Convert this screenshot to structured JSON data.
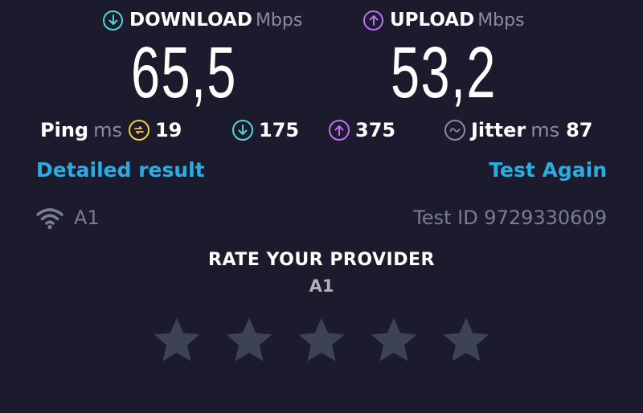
{
  "download": {
    "label": "DOWNLOAD",
    "unit": "Mbps",
    "value": "65,5",
    "icon": "arrow-down-circle-icon",
    "color": "#4fd6d2"
  },
  "upload": {
    "label": "UPLOAD",
    "unit": "Mbps",
    "value": "53,2",
    "icon": "arrow-up-circle-icon",
    "color": "#c06ff0"
  },
  "ping": {
    "label": "Ping",
    "unit": "ms",
    "value": "19",
    "icon": "ping-circle-icon",
    "color": "#f2cf3a"
  },
  "latency_download": {
    "value": "175",
    "icon": "arrow-down-circle-icon",
    "color": "#4fd6d2"
  },
  "latency_upload": {
    "value": "375",
    "icon": "arrow-up-circle-icon",
    "color": "#c06ff0"
  },
  "jitter": {
    "label": "Jitter",
    "unit": "ms",
    "value": "87",
    "icon": "jitter-circle-icon",
    "color": "#8a8c9c"
  },
  "links": {
    "detailed": "Detailed result",
    "test_again": "Test Again"
  },
  "provider": {
    "name": "A1",
    "icon": "wifi-icon"
  },
  "test_id": "Test ID 9729330609",
  "rating": {
    "title": "RATE YOUR PROVIDER",
    "provider": "A1",
    "stars": 5,
    "selected": 0,
    "star_color": "#3e4257"
  }
}
